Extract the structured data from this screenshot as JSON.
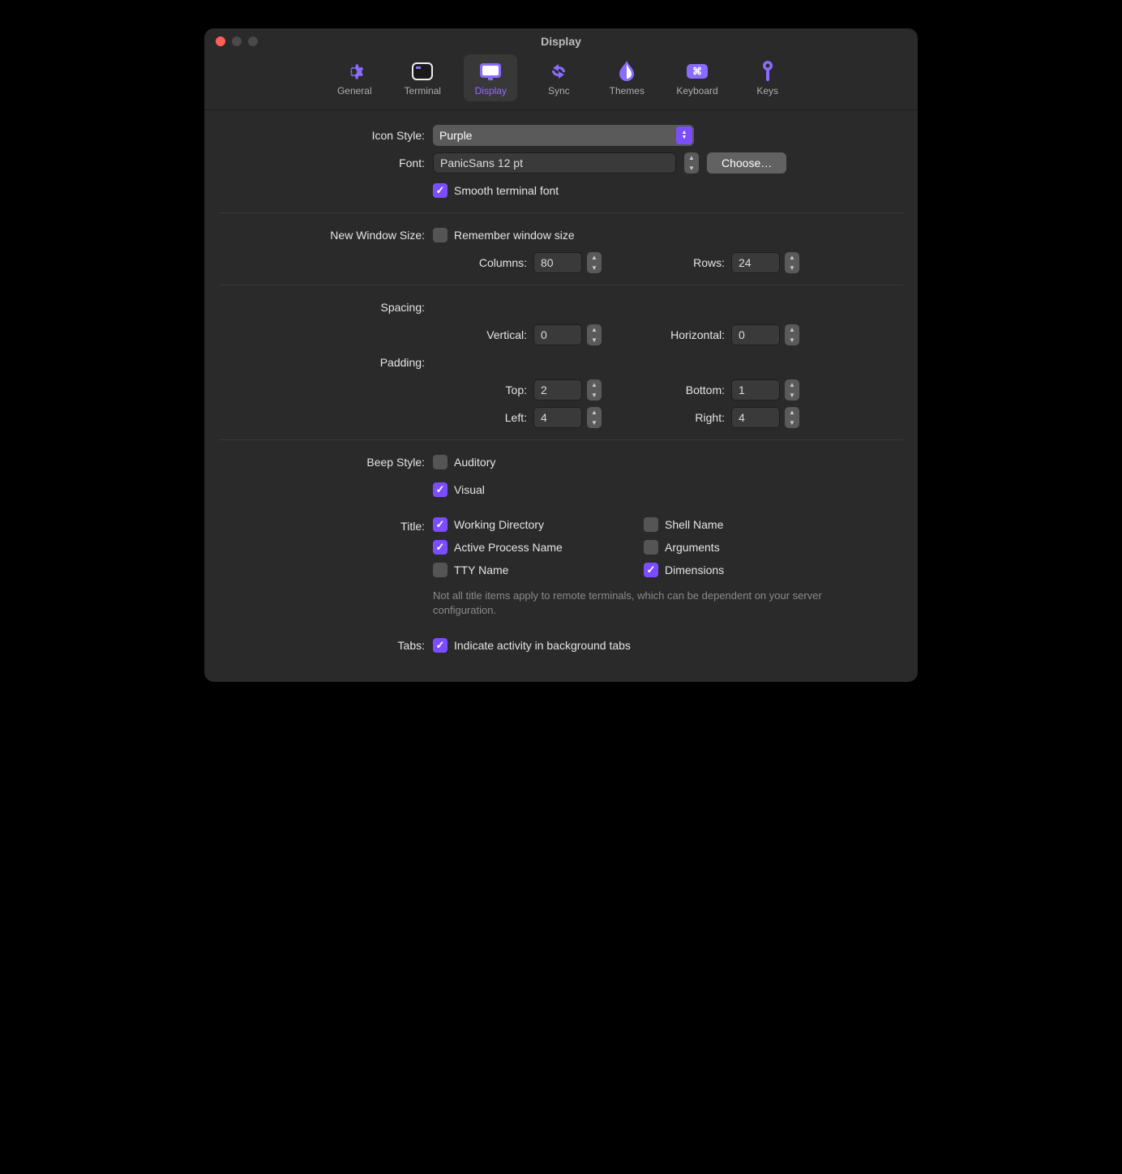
{
  "window": {
    "title": "Display"
  },
  "tabs": [
    {
      "label": "General"
    },
    {
      "label": "Terminal"
    },
    {
      "label": "Display"
    },
    {
      "label": "Sync"
    },
    {
      "label": "Themes"
    },
    {
      "label": "Keyboard"
    },
    {
      "label": "Keys"
    }
  ],
  "labels": {
    "iconStyle": "Icon Style:",
    "font": "Font:",
    "newWindowSize": "New Window Size:",
    "columns": "Columns:",
    "rows": "Rows:",
    "spacing": "Spacing:",
    "vertical": "Vertical:",
    "horizontal": "Horizontal:",
    "padding": "Padding:",
    "top": "Top:",
    "bottom": "Bottom:",
    "left": "Left:",
    "right": "Right:",
    "beepStyle": "Beep Style:",
    "title": "Title:",
    "tabs": "Tabs:"
  },
  "values": {
    "iconStyle": "Purple",
    "font": "PanicSans 12 pt",
    "chooseBtn": "Choose…",
    "smoothFont": "Smooth terminal font",
    "rememberSize": "Remember window size",
    "columns": "80",
    "rows": "24",
    "vertical": "0",
    "horizontal": "0",
    "top": "2",
    "bottom": "1",
    "left": "4",
    "right": "4",
    "auditory": "Auditory",
    "visual": "Visual",
    "workingDir": "Working Directory",
    "shellName": "Shell Name",
    "activeProcess": "Active Process Name",
    "arguments": "Arguments",
    "ttyName": "TTY Name",
    "dimensions": "Dimensions",
    "titleNote": "Not all title items apply to remote terminals, which can be dependent on your server configuration.",
    "indicateActivity": "Indicate activity in background tabs"
  },
  "checked": {
    "smoothFont": true,
    "rememberSize": false,
    "auditory": false,
    "visual": true,
    "workingDir": true,
    "shellName": false,
    "activeProcess": true,
    "arguments": false,
    "ttyName": false,
    "dimensions": true,
    "indicateActivity": true
  }
}
